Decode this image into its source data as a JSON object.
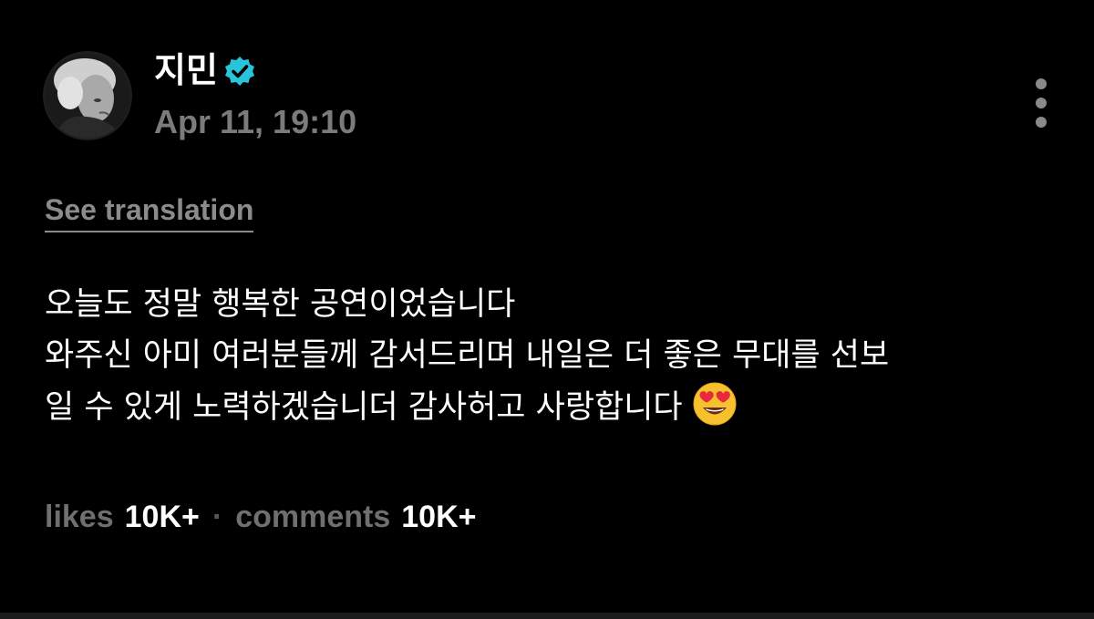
{
  "post": {
    "author": "지민",
    "timestamp": "Apr 11, 19:10",
    "see_translation": "See translation",
    "body_lines": [
      "오늘도 정말 행복한 공연이었습니다",
      "와주신 아미 여러분들께 감서드리며 내일은 더 좋은 무대를 선보",
      "일 수 있게 노력하겠습니더 감사허고 사랑합니다"
    ],
    "emoji": "heart-eyes-emoji"
  },
  "stats": {
    "likes_label": "likes",
    "likes_value": "10K+",
    "separator": "·",
    "comments_label": "comments",
    "comments_value": "10K+"
  },
  "icons": {
    "verified": "verified-badge-icon",
    "more": "more-options-icon"
  },
  "colors": {
    "background": "#000000",
    "text": "#ffffff",
    "muted": "#7b7b7b",
    "verified": "#27c4dc",
    "emoji_face": "#f7c12e",
    "emoji_heart": "#e8283c"
  }
}
